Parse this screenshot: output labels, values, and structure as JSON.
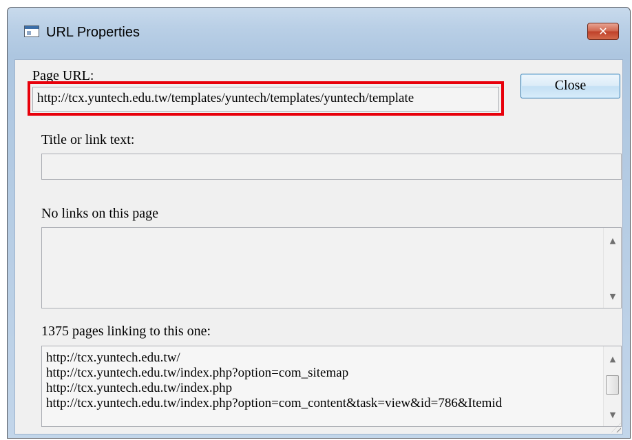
{
  "window": {
    "title": "URL Properties",
    "close_glyph": "✕"
  },
  "page_url": {
    "label": "Page URL:",
    "value": "http://tcx.yuntech.edu.tw/templates/yuntech/templates/yuntech/template"
  },
  "close_button": {
    "label": "Close"
  },
  "title_text": {
    "label": "Title or link text:",
    "value": ""
  },
  "outgoing": {
    "label": "No links on this page",
    "items": []
  },
  "incoming": {
    "label": "1375 pages linking to this one:",
    "items": [
      "http://tcx.yuntech.edu.tw/",
      "http://tcx.yuntech.edu.tw/index.php?option=com_sitemap",
      "http://tcx.yuntech.edu.tw/index.php",
      "http://tcx.yuntech.edu.tw/index.php?option=com_content&task=view&id=786&Itemid"
    ]
  },
  "icons": {
    "app": "window-icon",
    "scroll_up": "▲",
    "scroll_down": "▼"
  },
  "colors": {
    "highlight": "#e8000b",
    "close_button_red": "#c0402a",
    "frame_blue": "#b9cfe6"
  }
}
